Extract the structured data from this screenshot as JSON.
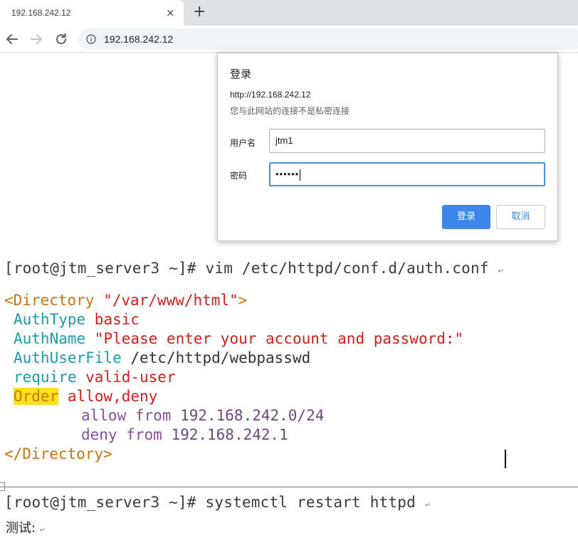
{
  "browser": {
    "tab_title": "192.168.242.12",
    "tab_close": "×",
    "new_tab": "+",
    "url": "192.168.242.12"
  },
  "dialog": {
    "title": "登录",
    "origin": "http://192.168.242.12",
    "warning": "您与此网站的连接不是私密连接",
    "username_label": "用户名",
    "username_value": "jtm1",
    "password_label": "密码",
    "password_value": "••••••",
    "login_button": "登录",
    "cancel_button": "取消"
  },
  "document": {
    "command1": "[root@jtm_server3 ~]# vim /etc/httpd/conf.d/auth.conf",
    "config": {
      "dir_open_tag": "<Directory ",
      "dir_open_path": "\"/var/www/html\"",
      "dir_open_close": ">",
      "authtype_key": "AuthType ",
      "authtype_val": "basic",
      "authname_key": "AuthName ",
      "authname_val": "\"Please enter your account and password:\"",
      "authuserfile_key": "AuthUserFile ",
      "authuserfile_val": "/etc/httpd/webpasswd",
      "require_key": "require ",
      "require_val": "valid-user",
      "order_key": "Order",
      "order_val": " allow,deny",
      "allow_kw": "allow from ",
      "allow_ip": "192.168.242.0/24",
      "deny_kw": "deny from ",
      "deny_ip": "192.168.242.1",
      "dir_close": "</Directory>"
    },
    "command2": "[root@jtm_server3 ~]# systemctl restart httpd",
    "test_label": "测试:",
    "para_mark": "↵"
  },
  "colors": {
    "accent_blue": "#3b86e7",
    "tag_orange": "#c77415",
    "string_red": "#d0211b",
    "directive_teal": "#1f9aa6",
    "highlight_yellow": "#ffe21a"
  }
}
